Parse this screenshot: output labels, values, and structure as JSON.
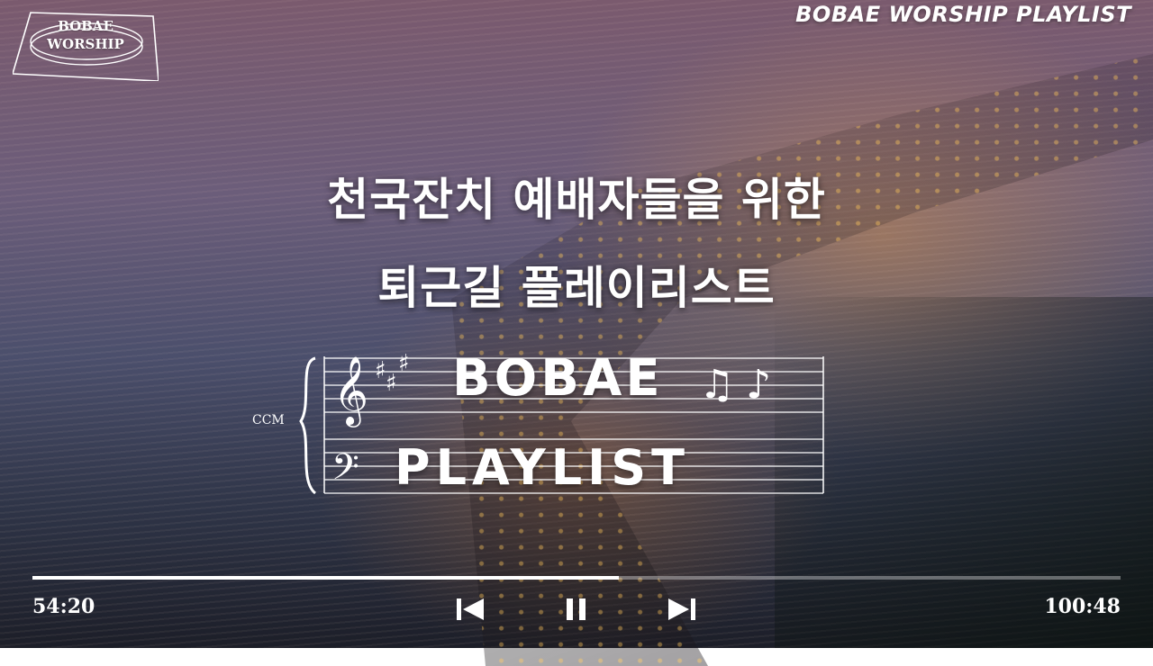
{
  "branding": {
    "logo_line1": "BOBAE",
    "logo_line2": "WORSHIP",
    "channel_title": "BOBAE WORSHIP PLAYLIST"
  },
  "headline": {
    "line1": "천국잔치 예배자들을 위한",
    "line2": "퇴근길 플레이리스트"
  },
  "score": {
    "label": "CCM",
    "word1": "BOBAE",
    "word2": "PLAYLIST",
    "icons": [
      "treble-clef-icon",
      "bass-clef-icon",
      "sharp-icon",
      "beamed-notes-icon",
      "eighth-note-icon"
    ]
  },
  "player": {
    "elapsed": "54:20",
    "duration": "100:48",
    "progress_fraction": 0.539,
    "controls": [
      "previous-track-icon",
      "pause-icon",
      "next-track-icon"
    ]
  },
  "colors": {
    "text": "#ffffff",
    "track": "#ffffff"
  }
}
